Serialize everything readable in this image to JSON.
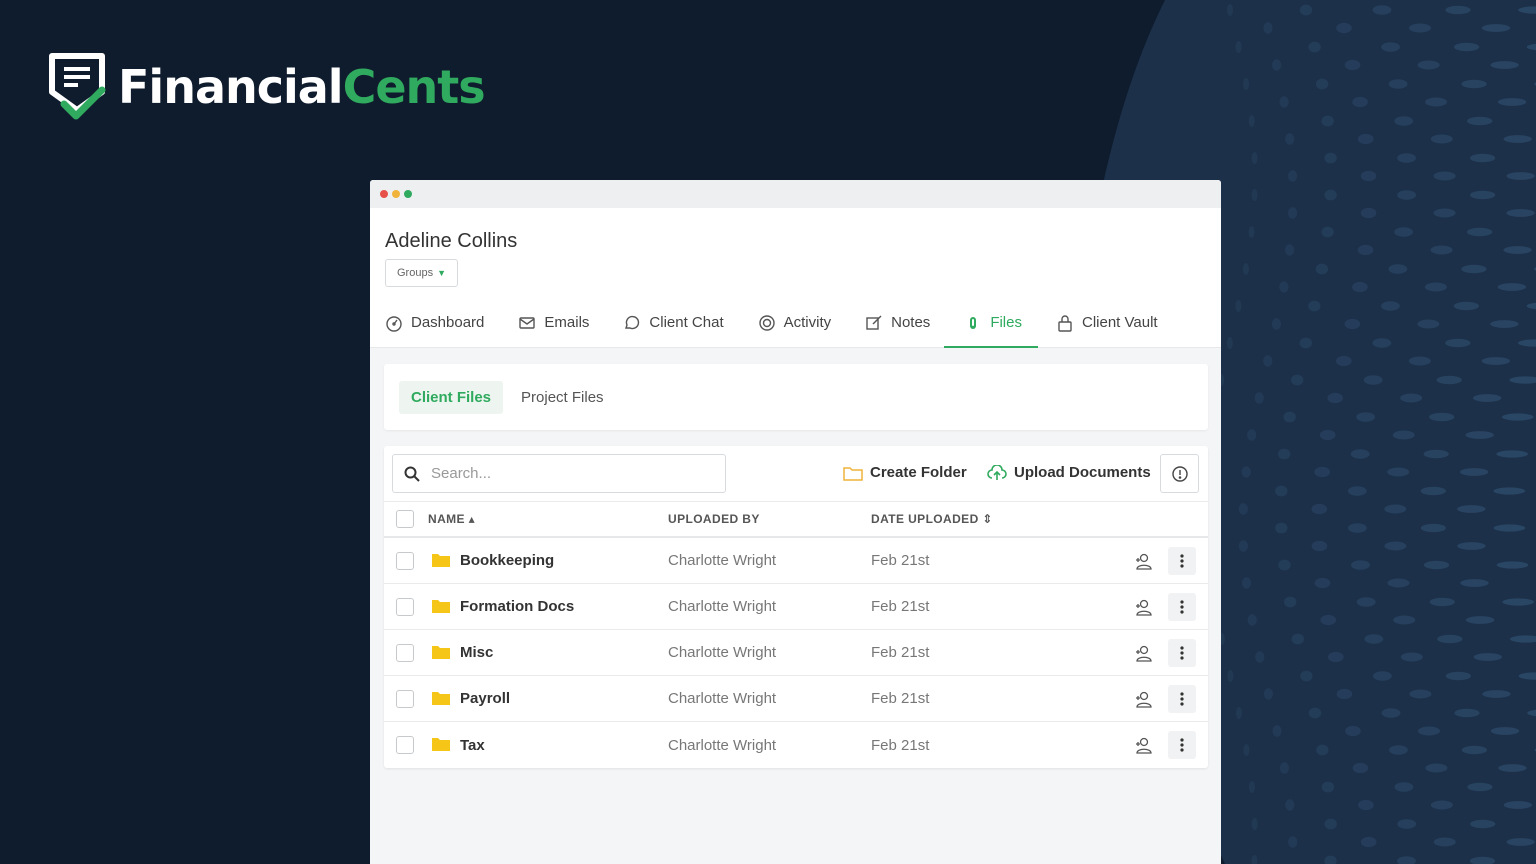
{
  "brand": {
    "word1": "Financial",
    "word2": "Cents",
    "green": "#2faa5e"
  },
  "window": {
    "dots": [
      "#e6524a",
      "#f0b43c",
      "#2faa5e"
    ]
  },
  "client": {
    "name": "Adeline Collins",
    "groups_label": "Groups"
  },
  "tabs": [
    {
      "label": "Dashboard",
      "icon": "dashboard-gauge-icon"
    },
    {
      "label": "Emails",
      "icon": "envelope-icon"
    },
    {
      "label": "Client Chat",
      "icon": "chat-bubble-icon"
    },
    {
      "label": "Activity",
      "icon": "activity-icon"
    },
    {
      "label": "Notes",
      "icon": "edit-note-icon"
    },
    {
      "label": "Files",
      "icon": "paperclip-icon",
      "active": true
    },
    {
      "label": "Client Vault",
      "icon": "lock-icon"
    }
  ],
  "subtabs": {
    "client_files": "Client Files",
    "project_files": "Project Files"
  },
  "toolbar": {
    "search_placeholder": "Search...",
    "create_folder": "Create Folder",
    "upload_documents": "Upload Documents"
  },
  "table": {
    "headers": {
      "name": "NAME",
      "uploaded_by": "UPLOADED BY",
      "date_uploaded": "DATE UPLOADED"
    },
    "rows": [
      {
        "name": "Bookkeeping",
        "by": "Charlotte Wright",
        "date": "Feb 21st"
      },
      {
        "name": "Formation Docs",
        "by": "Charlotte Wright",
        "date": "Feb 21st"
      },
      {
        "name": "Misc",
        "by": "Charlotte Wright",
        "date": "Feb 21st"
      },
      {
        "name": "Payroll",
        "by": "Charlotte Wright",
        "date": "Feb 21st"
      },
      {
        "name": "Tax",
        "by": "Charlotte Wright",
        "date": "Feb 21st"
      }
    ]
  }
}
